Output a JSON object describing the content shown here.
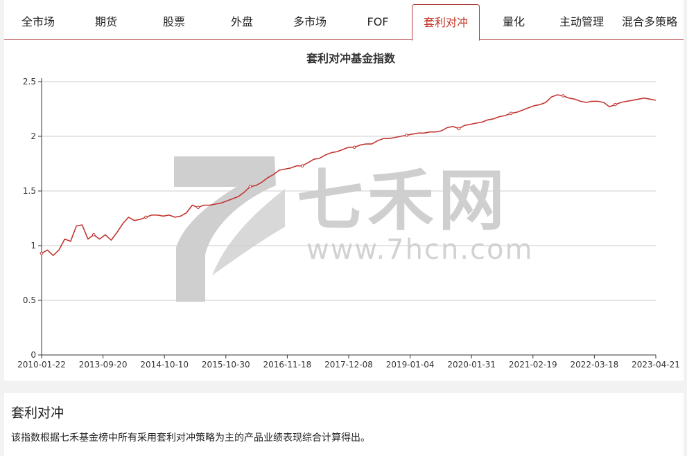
{
  "tabs": [
    {
      "label": "全市场",
      "active": false
    },
    {
      "label": "期货",
      "active": false
    },
    {
      "label": "股票",
      "active": false
    },
    {
      "label": "外盘",
      "active": false
    },
    {
      "label": "多市场",
      "active": false
    },
    {
      "label": "FOF",
      "active": false
    },
    {
      "label": "套利对冲",
      "active": true
    },
    {
      "label": "量化",
      "active": false
    },
    {
      "label": "主动管理",
      "active": false
    },
    {
      "label": "混合多策略",
      "active": false
    }
  ],
  "watermark": {
    "brand": "七禾网",
    "url": "www.7hcn.com"
  },
  "colors": {
    "accent": "#b23a3a",
    "line": "#c23531",
    "grid": "#cccccc"
  },
  "description": {
    "title": "套利对冲",
    "text": "该指数根据七禾基金榜中所有采用套利对冲策略为主的产品业绩表现综合计算得出。"
  },
  "chart_data": {
    "type": "line",
    "title": "套利对冲基金指数",
    "xlabel": "",
    "ylabel": "",
    "ylim": [
      0,
      2.5
    ],
    "yticks": [
      "0",
      "0.5",
      "1",
      "1.5",
      "2",
      "2.5"
    ],
    "xtick_labels": [
      "2010-01-22",
      "2013-09-20",
      "2014-10-10",
      "2015-10-30",
      "2016-11-18",
      "2017-12-08",
      "2019-01-04",
      "2020-01-31",
      "2021-02-19",
      "2022-03-18",
      "2023-04-21"
    ],
    "grid": true,
    "legend": "none",
    "series": [
      {
        "values": [
          0.93,
          0.96,
          0.91,
          0.96,
          1.06,
          1.04,
          1.18,
          1.19,
          1.06,
          1.1,
          1.06,
          1.1,
          1.05,
          1.12,
          1.2,
          1.26,
          1.23,
          1.24,
          1.26,
          1.28,
          1.28,
          1.27,
          1.28,
          1.26,
          1.27,
          1.3,
          1.37,
          1.35,
          1.37,
          1.37,
          1.38,
          1.39,
          1.41,
          1.43,
          1.45,
          1.49,
          1.54,
          1.55,
          1.58,
          1.62,
          1.65,
          1.69,
          1.7,
          1.71,
          1.73,
          1.73,
          1.76,
          1.79,
          1.8,
          1.83,
          1.85,
          1.86,
          1.88,
          1.9,
          1.9,
          1.92,
          1.93,
          1.93,
          1.96,
          1.98,
          1.98,
          1.99,
          2.0,
          2.01,
          2.02,
          2.03,
          2.03,
          2.04,
          2.04,
          2.05,
          2.08,
          2.09,
          2.07,
          2.1,
          2.11,
          2.12,
          2.13,
          2.15,
          2.16,
          2.18,
          2.19,
          2.21,
          2.22,
          2.24,
          2.26,
          2.28,
          2.29,
          2.31,
          2.36,
          2.38,
          2.37,
          2.35,
          2.34,
          2.32,
          2.31,
          2.32,
          2.32,
          2.31,
          2.27,
          2.29,
          2.31,
          2.32,
          2.33,
          2.34,
          2.35,
          2.34,
          2.33
        ]
      }
    ]
  }
}
